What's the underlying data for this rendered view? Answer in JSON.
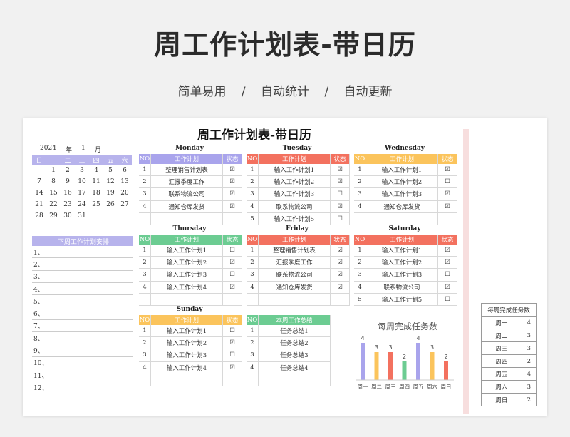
{
  "header": {
    "title": "周工作计划表-带日历",
    "sub": [
      "简单易用",
      "/",
      "自动统计",
      "/",
      "自动更新"
    ]
  },
  "sheet": {
    "title": "周工作计划表-带日历"
  },
  "calendar": {
    "year": "2024",
    "year_label": "年",
    "month": "1",
    "month_label": "月",
    "weekdays": [
      "日",
      "一",
      "二",
      "三",
      "四",
      "五",
      "六"
    ],
    "weeks": [
      [
        "",
        "1",
        "2",
        "3",
        "4",
        "5",
        "6"
      ],
      [
        "7",
        "8",
        "9",
        "10",
        "11",
        "12",
        "13"
      ],
      [
        "14",
        "15",
        "16",
        "17",
        "18",
        "19",
        "20"
      ],
      [
        "21",
        "22",
        "23",
        "24",
        "25",
        "26",
        "27"
      ],
      [
        "28",
        "29",
        "30",
        "31",
        "",
        "",
        ""
      ]
    ]
  },
  "next_week": {
    "header": "下周工作计划安排",
    "rows": [
      "1、",
      "2、",
      "3、",
      "4、",
      "5、",
      "6、",
      "7、",
      "8、",
      "9、",
      "10、",
      "11、",
      "12、"
    ]
  },
  "colors": {
    "monday": "#a9a4ec",
    "tuesday": "#f3715f",
    "wednesday": "#fbc45c",
    "thursday": "#6ccc92",
    "friday": "#f3715f",
    "saturday": "#f3715f",
    "sunday": "#fbc45c",
    "summary": "#6ccc92"
  },
  "cols": {
    "no": "NO",
    "task": "工作计划",
    "status": "状态"
  },
  "days": {
    "monday": {
      "name": "Monday",
      "rows": [
        [
          "1",
          "整理销售计划表",
          "☑"
        ],
        [
          "2",
          "汇报季度工作",
          "☑"
        ],
        [
          "3",
          "联系物流公司",
          "☑"
        ],
        [
          "4",
          "通知仓库发货",
          "☑"
        ],
        [
          "",
          "",
          ""
        ]
      ]
    },
    "tuesday": {
      "name": "Tuesday",
      "rows": [
        [
          "1",
          "输入工作计划1",
          "☑"
        ],
        [
          "2",
          "输入工作计划2",
          "☑"
        ],
        [
          "3",
          "输入工作计划3",
          "☐"
        ],
        [
          "4",
          "联系物流公司",
          "☑"
        ],
        [
          "5",
          "输入工作计划5",
          "☐"
        ]
      ]
    },
    "wednesday": {
      "name": "Wednesday",
      "rows": [
        [
          "1",
          "输入工作计划1",
          "☑"
        ],
        [
          "2",
          "输入工作计划2",
          "☐"
        ],
        [
          "3",
          "输入工作计划3",
          "☑"
        ],
        [
          "4",
          "通知仓库发货",
          "☑"
        ],
        [
          "",
          "",
          ""
        ]
      ]
    },
    "thursday": {
      "name": "Thursday",
      "rows": [
        [
          "1",
          "输入工作计划1",
          "☐"
        ],
        [
          "2",
          "输入工作计划2",
          "☑"
        ],
        [
          "3",
          "输入工作计划3",
          "☐"
        ],
        [
          "4",
          "输入工作计划4",
          "☑"
        ],
        [
          "",
          "",
          ""
        ]
      ]
    },
    "friday": {
      "name": "Friday",
      "rows": [
        [
          "1",
          "整理销售计划表",
          "☑"
        ],
        [
          "2",
          "汇报季度工作",
          "☑"
        ],
        [
          "3",
          "联系物流公司",
          "☑"
        ],
        [
          "4",
          "通知仓库发货",
          "☑"
        ],
        [
          "",
          "",
          ""
        ]
      ]
    },
    "saturday": {
      "name": "Saturday",
      "rows": [
        [
          "1",
          "输入工作计划1",
          "☑"
        ],
        [
          "2",
          "输入工作计划2",
          "☑"
        ],
        [
          "3",
          "输入工作计划3",
          "☐"
        ],
        [
          "4",
          "联系物流公司",
          "☑"
        ],
        [
          "5",
          "输入工作计划5",
          "☐"
        ]
      ]
    },
    "sunday": {
      "name": "Sunday",
      "rows": [
        [
          "1",
          "输入工作计划1",
          "☐"
        ],
        [
          "2",
          "输入工作计划2",
          "☑"
        ],
        [
          "3",
          "输入工作计划3",
          "☐"
        ],
        [
          "4",
          "输入工作计划4",
          "☑"
        ],
        [
          "",
          "",
          ""
        ]
      ]
    }
  },
  "summary": {
    "header": "本周工作总结",
    "rows": [
      [
        "1",
        "任务总结1"
      ],
      [
        "2",
        "任务总结2"
      ],
      [
        "3",
        "任务总结3"
      ],
      [
        "4",
        "任务总结4"
      ],
      [
        "",
        ""
      ]
    ]
  },
  "weekly_stats": {
    "header": "每周完成任务数",
    "rows": [
      [
        "周一",
        "4"
      ],
      [
        "周二",
        "3"
      ],
      [
        "周三",
        "3"
      ],
      [
        "周四",
        "2"
      ],
      [
        "周五",
        "4"
      ],
      [
        "周六",
        "3"
      ],
      [
        "周日",
        "2"
      ]
    ]
  },
  "chart_data": {
    "type": "bar",
    "title": "每周完成任务数",
    "categories": [
      "周一",
      "周二",
      "周三",
      "周四",
      "周五",
      "周六",
      "周日"
    ],
    "values": [
      4,
      3,
      3,
      2,
      4,
      3,
      2
    ],
    "colors": [
      "#a9a4ec",
      "#fbc45c",
      "#f3715f",
      "#6ccc92",
      "#a9a4ec",
      "#fbc45c",
      "#f3715f"
    ],
    "ylim": [
      0,
      4
    ]
  }
}
